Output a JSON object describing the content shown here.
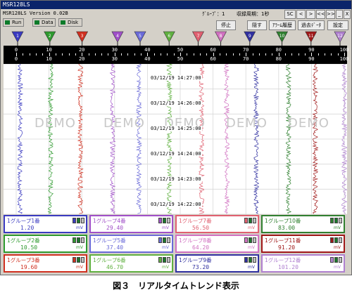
{
  "window": {
    "title": "MSR128LS",
    "version": "MSR128LS Version 0.02B",
    "group_label": "ｸﾞﾙｰﾌﾟ：1",
    "interval_label": "収録周期：1秒"
  },
  "indicators": [
    {
      "label": "Run",
      "color": "#0c7b2a"
    },
    {
      "label": "Data",
      "color": "#0c7b2a"
    },
    {
      "label": "Disk",
      "color": "#0c7b2a"
    }
  ],
  "nav_buttons": [
    "SC",
    "<",
    ">",
    "<<",
    ">>",
    "_",
    "X"
  ],
  "toolbar": {
    "stop": "停止",
    "hide": "隠す",
    "alarm": "ｱﾗｰﾑ履歴",
    "past": "過去ﾃﾞｰﾀ",
    "settings": "設定"
  },
  "markers": [
    {
      "label": "1",
      "color": "#3a3ac0",
      "pos": 0
    },
    {
      "label": "2",
      "color": "#2e9a2e",
      "pos": 10
    },
    {
      "label": "3",
      "color": "#d03020",
      "pos": 20
    },
    {
      "label": "4",
      "color": "#a050c8",
      "pos": 31
    },
    {
      "label": "5",
      "color": "#6a6ad8",
      "pos": 38
    },
    {
      "label": "6",
      "color": "#60b040",
      "pos": 47
    },
    {
      "label": "7",
      "color": "#e06070",
      "pos": 56
    },
    {
      "label": "8",
      "color": "#d070c0",
      "pos": 63
    },
    {
      "label": "9",
      "color": "#3030a0",
      "pos": 72
    },
    {
      "label": "10",
      "color": "#308030",
      "pos": 82
    },
    {
      "label": "11",
      "color": "#a01818",
      "pos": 91
    },
    {
      "label": "12",
      "color": "#b080d0",
      "pos": 100
    }
  ],
  "scale": {
    "upper_ticks": [
      "0",
      "10",
      "20",
      "30",
      "40",
      "50",
      "60",
      "70",
      "80",
      "90",
      "100"
    ],
    "lower_ticks": [
      "0",
      "10",
      "20",
      "30",
      "40",
      "50",
      "60",
      "70",
      "80",
      "90",
      "100"
    ]
  },
  "watermark": "DEMO",
  "timestamps": [
    "03/12/19  14:27:00",
    "03/12/19  14:26:00",
    "03/12/19  14:25:00",
    "03/12/19  14:24:00",
    "03/12/19  14:23:00",
    "03/12/19  14:22:00"
  ],
  "channels": [
    {
      "name": "1グループ1番",
      "value": "1.20",
      "unit": "mV",
      "color": "#3a3ac0"
    },
    {
      "name": "1グループ4番",
      "value": "29.40",
      "unit": "mV",
      "color": "#a050c8"
    },
    {
      "name": "1グループ7番",
      "value": "56.50",
      "unit": "mV",
      "color": "#e06070"
    },
    {
      "name": "1グループ10番",
      "value": "83.00",
      "unit": "mV",
      "color": "#308030"
    },
    {
      "name": "1グループ2番",
      "value": "10.50",
      "unit": "mV",
      "color": "#2e9a2e"
    },
    {
      "name": "1グループ5番",
      "value": "37.40",
      "unit": "mV",
      "color": "#6a6ad8"
    },
    {
      "name": "1グループ8番",
      "value": "64.20",
      "unit": "mV",
      "color": "#d070c0"
    },
    {
      "name": "1グループ11番",
      "value": "91.20",
      "unit": "mV",
      "color": "#a01818"
    },
    {
      "name": "1グループ3番",
      "value": "19.60",
      "unit": "mV",
      "color": "#d03020"
    },
    {
      "name": "1グループ6番",
      "value": "46.70",
      "unit": "mV",
      "color": "#60b040"
    },
    {
      "name": "1グループ9番",
      "value": "73.20",
      "unit": "mV",
      "color": "#3030a0"
    },
    {
      "name": "1グループ12番",
      "value": "101.20",
      "unit": "mV",
      "color": "#b080d0"
    }
  ],
  "caption": "図３　リアルタイムトレンド表示"
}
